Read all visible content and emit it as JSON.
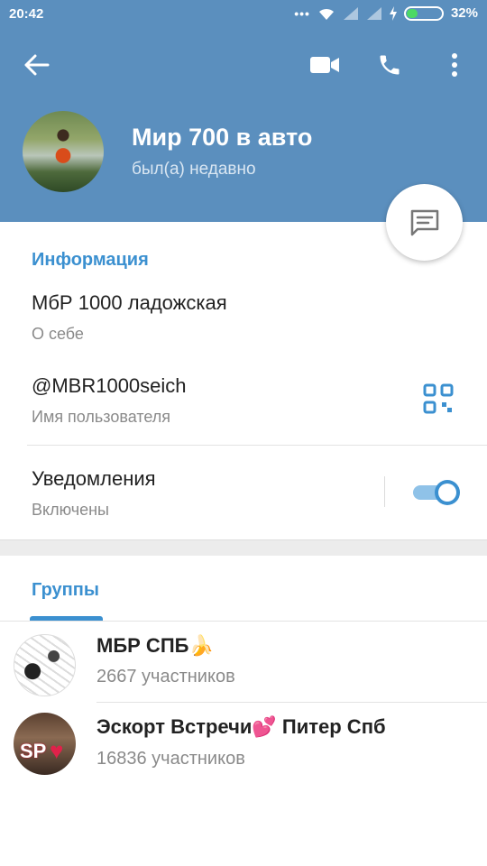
{
  "status_bar": {
    "time": "20:42",
    "dots": "•••",
    "battery_pct": "32%",
    "battery_level": 0.32
  },
  "header": {
    "name": "Мир 700 в авто",
    "last_seen": "был(а) недавно",
    "colors": {
      "background": "#5b8fbe",
      "accent": "#3b90d0"
    }
  },
  "toolbar": {
    "icons": [
      "back-arrow-icon",
      "video-camera-icon",
      "phone-icon",
      "more-vert-icon"
    ]
  },
  "info": {
    "section_title": "Информация",
    "bio": "МбР 1000 ладожская",
    "bio_label": "О себе",
    "username": "@MBR1000seich",
    "username_label": "Имя пользователя",
    "notifications": "Уведомления",
    "notifications_state": "Включены",
    "notifications_enabled": true
  },
  "groups": {
    "tab_label": "Группы",
    "items": [
      {
        "name": "МБР СПБ🍌",
        "members": "2667 участников"
      },
      {
        "name": "Эскорт Встречи💕 Питер Спб",
        "members": "16836 участников",
        "avatar_text": "SP"
      }
    ]
  }
}
